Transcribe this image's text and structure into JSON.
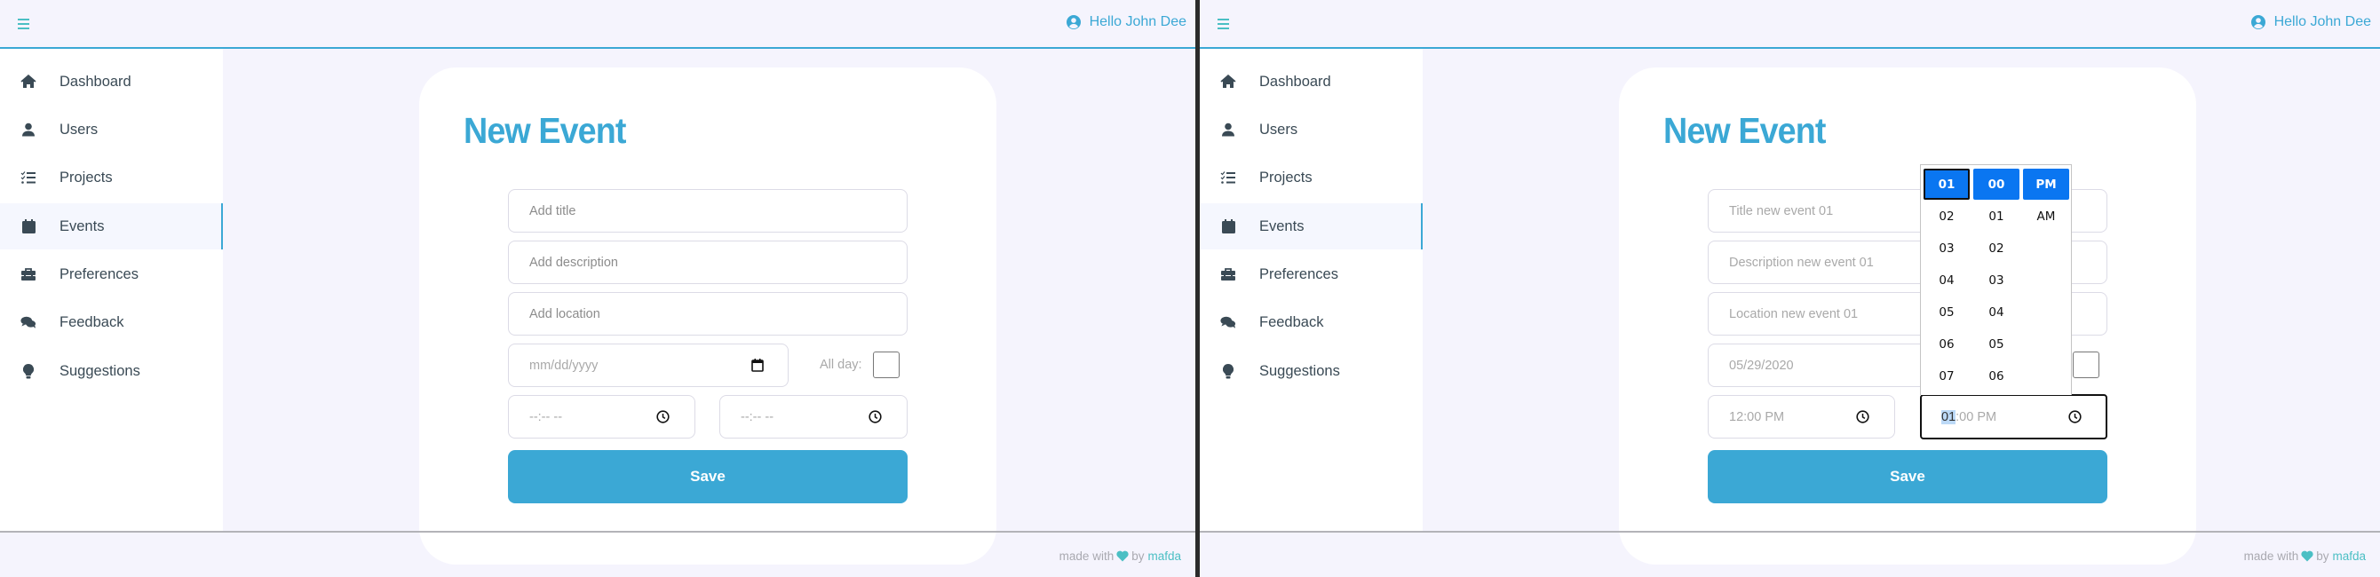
{
  "header": {
    "menu_icon": "hamburger-icon",
    "greeting": "Hello John Dee",
    "user_icon": "user-circle-icon"
  },
  "sidebar": {
    "active": "Events",
    "items": [
      {
        "label": "Dashboard",
        "icon": "home-icon"
      },
      {
        "label": "Users",
        "icon": "user-icon"
      },
      {
        "label": "Projects",
        "icon": "tasks-icon"
      },
      {
        "label": "Events",
        "icon": "calendar-icon"
      },
      {
        "label": "Preferences",
        "icon": "toolbox-icon"
      },
      {
        "label": "Feedback",
        "icon": "comments-icon"
      },
      {
        "label": "Suggestions",
        "icon": "lightbulb-icon"
      }
    ]
  },
  "form": {
    "title": "New Event",
    "all_day_label": "All day:",
    "save_label": "Save"
  },
  "left_panel": {
    "title_placeholder": "Add title",
    "description_placeholder": "Add description",
    "location_placeholder": "Add location",
    "date_placeholder": "mm/dd/yyyy",
    "start_time_placeholder": "--:-- --",
    "end_time_placeholder": "--:-- --",
    "all_day_checked": false
  },
  "right_panel": {
    "title_value": "Title new event 01",
    "description_value": "Description new event 01",
    "location_value": "Location new event 01",
    "date_value": "05/29/2020",
    "start_time_value": "12:00 PM",
    "end_time_hour": "01",
    "end_time_rest": ":00 PM",
    "all_day_checked": false,
    "time_picker": {
      "hours": [
        "01",
        "02",
        "03",
        "04",
        "05",
        "06",
        "07"
      ],
      "minutes": [
        "00",
        "01",
        "02",
        "03",
        "04",
        "05",
        "06"
      ],
      "ampm": [
        "PM",
        "AM"
      ],
      "selected_hour": "01",
      "selected_minute": "00",
      "selected_ampm": "PM"
    }
  },
  "footer": {
    "made_with": "made with",
    "by": "by",
    "brand": "mafda"
  },
  "colors": {
    "accent": "#3ba8d5",
    "teal": "#4bbfc4",
    "background": "#f5f4fd",
    "text_dark": "#3a4a55",
    "picker_selected": "#0a76f1"
  }
}
